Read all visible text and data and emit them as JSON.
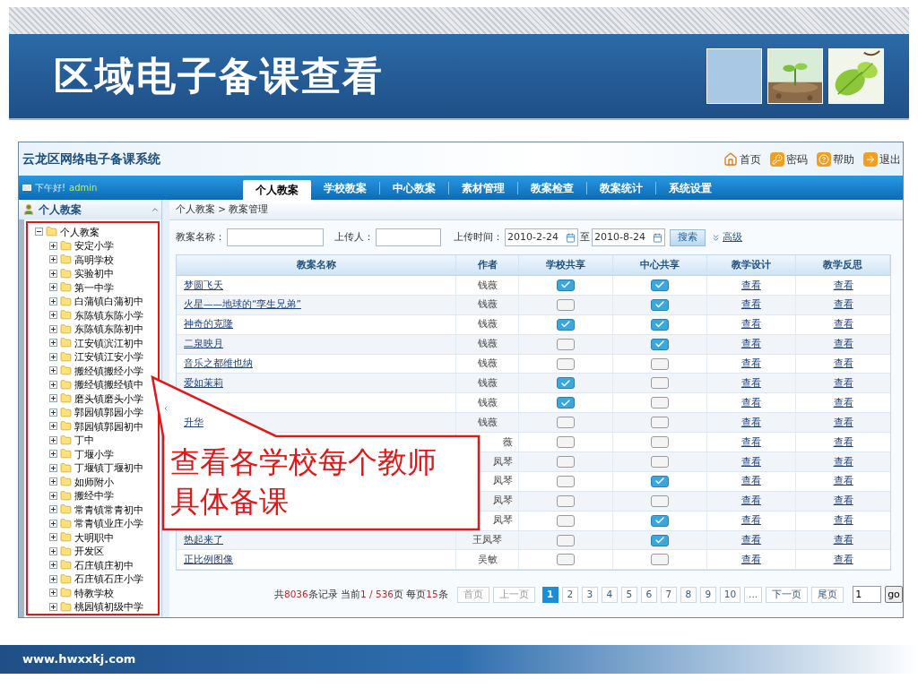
{
  "slide": {
    "title": "区域电子备课查看",
    "footer": "www.hwxxkj.com"
  },
  "app": {
    "title": "云龙区网络电子备课系统",
    "top_links": [
      {
        "label": "首页",
        "kind": "home"
      },
      {
        "label": "密码",
        "kind": "key"
      },
      {
        "label": "帮助",
        "kind": "help"
      },
      {
        "label": "退出",
        "kind": "exit"
      }
    ],
    "greeting": "下午好!",
    "user": "admin",
    "tabs": [
      {
        "label": "个人教案",
        "selected": true
      },
      {
        "label": "学校教案",
        "selected": false
      },
      {
        "label": "中心教案",
        "selected": false
      },
      {
        "label": "素材管理",
        "selected": false
      },
      {
        "label": "教案检查",
        "selected": false
      },
      {
        "label": "教案统计",
        "selected": false
      },
      {
        "label": "系统设置",
        "selected": false
      }
    ],
    "sidebar": {
      "title": "个人教案",
      "tree": [
        {
          "label": "个人教案",
          "expanded": true,
          "children": [
            {
              "label": "安定小学",
              "expanded": false
            },
            {
              "label": "高明学校",
              "expanded": false
            },
            {
              "label": "实验初中",
              "expanded": false
            },
            {
              "label": "第一中学",
              "expanded": false
            },
            {
              "label": "白蒲镇白蒲初中",
              "expanded": false
            },
            {
              "label": "东陈镇东陈小学",
              "expanded": false
            },
            {
              "label": "东陈镇东陈初中",
              "expanded": false
            },
            {
              "label": "江安镇滨江初中",
              "expanded": false
            },
            {
              "label": "江安镇江安小学",
              "expanded": false
            },
            {
              "label": "搬经镇搬经小学",
              "expanded": false
            },
            {
              "label": "搬经镇搬经镇中",
              "expanded": false
            },
            {
              "label": "磨头镇磨头小学",
              "expanded": false
            },
            {
              "label": "郭园镇郭园小学",
              "expanded": false
            },
            {
              "label": "郭园镇郭园初中",
              "expanded": false
            },
            {
              "label": "丁中",
              "expanded": false
            },
            {
              "label": "丁堰小学",
              "expanded": false
            },
            {
              "label": "丁堰镇丁堰初中",
              "expanded": false
            },
            {
              "label": "如师附小",
              "expanded": false
            },
            {
              "label": "搬经中学",
              "expanded": false
            },
            {
              "label": "常青镇常青初中",
              "expanded": false
            },
            {
              "label": "常青镇业庄小学",
              "expanded": false
            },
            {
              "label": "大明职中",
              "expanded": false
            },
            {
              "label": "开发区",
              "expanded": false
            },
            {
              "label": "石庄镇庄初中",
              "expanded": false
            },
            {
              "label": "石庄镇石庄小学",
              "expanded": false
            },
            {
              "label": "特教学校",
              "expanded": false
            },
            {
              "label": "桃园镇初级中学",
              "expanded": false
            }
          ]
        }
      ]
    },
    "breadcrumb": "个人教案 > 教案管理",
    "search": {
      "name_label": "教案名称：",
      "uploader_label": "上传人：",
      "time_label": "上传时间：",
      "date_from": "2010-2-24",
      "to_label": "至",
      "date_to": "2010-8-24",
      "button": "搜索",
      "advanced": "高级"
    },
    "table": {
      "columns": [
        "教案名称",
        "作者",
        "学校共享",
        "中心共享",
        "教学设计",
        "教学反思"
      ],
      "rows": [
        {
          "kind": "plain",
          "name": "梦圆飞天",
          "author": "钱薇",
          "school_shared": true,
          "center_shared": true,
          "design": "查看",
          "reflection": "查看"
        },
        {
          "kind": "plain",
          "name": "火星——地球的“孪生兄弟”",
          "author": "钱薇",
          "school_shared": false,
          "center_shared": true,
          "design": "查看",
          "reflection": "查看"
        },
        {
          "kind": "plain",
          "name": "神奇的克隆",
          "author": "钱薇",
          "school_shared": true,
          "center_shared": true,
          "design": "查看",
          "reflection": "查看"
        },
        {
          "kind": "plain",
          "name": "二泉映月",
          "author": "钱薇",
          "school_shared": false,
          "center_shared": true,
          "design": "查看",
          "reflection": "查看"
        },
        {
          "kind": "plain",
          "name": "音乐之都维也纳",
          "author": "钱薇",
          "school_shared": false,
          "center_shared": false,
          "design": "查看",
          "reflection": "查看"
        },
        {
          "kind": "plain",
          "name": "爱如茉莉",
          "author": "钱薇",
          "school_shared": true,
          "center_shared": false,
          "design": "查看",
          "reflection": "查看"
        },
        {
          "kind": "plain",
          "author": "钱薇",
          "school_shared": true,
          "center_shared": false,
          "design": "查看",
          "reflection": "查看"
        },
        {
          "kind": "plain",
          "name": "升华",
          "author": "钱薇",
          "school_shared": false,
          "center_shared": false,
          "design": "查看",
          "reflection": "查看"
        },
        {
          "kind": "covered",
          "author": "薇",
          "school_shared": false,
          "center_shared": false,
          "design": "查看",
          "reflection": "查看"
        },
        {
          "kind": "covered",
          "author": "凤琴",
          "school_shared": false,
          "center_shared": false,
          "design": "查看",
          "reflection": "查看"
        },
        {
          "kind": "covered",
          "author": "凤琴",
          "school_shared": false,
          "center_shared": true,
          "design": "查看",
          "reflection": "查看"
        },
        {
          "kind": "covered",
          "author": "凤琴",
          "school_shared": false,
          "center_shared": false,
          "design": "查看",
          "reflection": "查看"
        },
        {
          "kind": "covered",
          "author": "凤琴",
          "school_shared": false,
          "center_shared": true,
          "design": "查看",
          "reflection": "查看"
        },
        {
          "kind": "plain",
          "name": "热起来了",
          "author": "王凤琴",
          "school_shared": false,
          "center_shared": true,
          "design": "查看",
          "reflection": "查看"
        },
        {
          "kind": "plain",
          "name": "正比例图像",
          "author": "吴敏",
          "school_shared": false,
          "center_shared": false,
          "design": "查看",
          "reflection": "查看"
        }
      ]
    },
    "pagination": {
      "summary": [
        {
          "text": "共",
          "highlight": false
        },
        {
          "text": "8036",
          "highlight": true
        },
        {
          "text": "条记录 当前",
          "highlight": false
        },
        {
          "text": "1 / 536",
          "highlight": true
        },
        {
          "text": "页 每页",
          "highlight": false
        },
        {
          "text": "15",
          "highlight": true
        },
        {
          "text": "条",
          "highlight": false
        }
      ],
      "first": "首页",
      "prev": "上一页",
      "pages": [
        {
          "label": "1",
          "selected": true
        },
        {
          "label": "2",
          "selected": false
        },
        {
          "label": "3",
          "selected": false
        },
        {
          "label": "4",
          "selected": false
        },
        {
          "label": "5",
          "selected": false
        },
        {
          "label": "6",
          "selected": false
        },
        {
          "label": "7",
          "selected": false
        },
        {
          "label": "8",
          "selected": false
        },
        {
          "label": "9",
          "selected": false
        },
        {
          "label": "10",
          "selected": false
        },
        {
          "label": "...",
          "selected": false
        }
      ],
      "next": "下一页",
      "last": "尾页",
      "page_input": "1",
      "go": "go"
    }
  },
  "callout": "查看各学校每个教师具体备课"
}
